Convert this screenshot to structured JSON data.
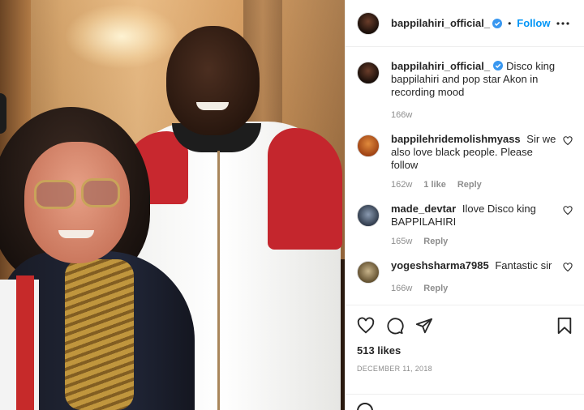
{
  "post": {
    "author": "bappilahiri_official_",
    "follow_label": "Follow",
    "separator": "•",
    "colors": {
      "link": "#0095f6",
      "verified": "#3897f0",
      "muted": "#8e8e8e"
    }
  },
  "caption": {
    "username": "bappilahiri_official_",
    "text": "Disco king bappilahiri and pop star Akon in recording mood",
    "time": "166w"
  },
  "comments": [
    {
      "username": "bappilehridemolishmyass",
      "text": "Sir we also love black people. Please follow",
      "time": "162w",
      "likes": "1 like",
      "reply": "Reply"
    },
    {
      "username": "made_devtar",
      "text": "Ilove Disco king BAPPILAHIRI",
      "time": "165w",
      "reply": "Reply"
    },
    {
      "username": "yogeshsharma7985",
      "text": "Fantastic sir",
      "time": "166w",
      "reply": "Reply"
    }
  ],
  "actions": {
    "icons": [
      "heart-icon",
      "comment-icon",
      "share-icon",
      "bookmark-icon"
    ],
    "likes": "513 likes",
    "date": "DECEMBER 11, 2018"
  }
}
